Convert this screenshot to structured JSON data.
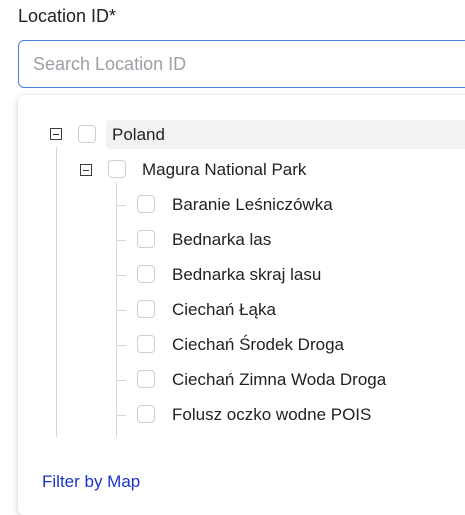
{
  "field": {
    "label": "Location ID*",
    "placeholder": "Search Location ID"
  },
  "tree": {
    "root": {
      "label": "Poland",
      "expanded": true,
      "checked": false,
      "children": [
        {
          "label": "Magura National Park",
          "expanded": true,
          "checked": false,
          "children": [
            {
              "label": "Baranie Leśniczówka",
              "checked": false
            },
            {
              "label": "Bednarka las",
              "checked": false
            },
            {
              "label": "Bednarka skraj lasu",
              "checked": false
            },
            {
              "label": "Ciechań Łąka",
              "checked": false
            },
            {
              "label": "Ciechań Środek Droga",
              "checked": false
            },
            {
              "label": "Ciechań Zimna Woda Droga",
              "checked": false
            },
            {
              "label": "Folusz oczko wodne POIS",
              "checked": false
            }
          ]
        }
      ]
    }
  },
  "footer": {
    "filter_by_map": "Filter by Map"
  },
  "colors": {
    "input_border": "#4a7fe0",
    "link": "#1a33c9",
    "selected_row_bg": "#f2f2f2"
  }
}
